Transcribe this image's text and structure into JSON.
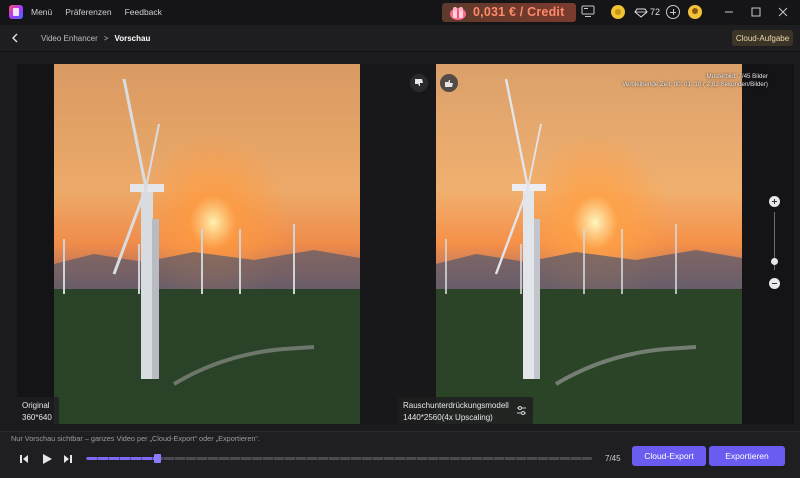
{
  "titlebar": {
    "menu": [
      "Menü",
      "Präferenzen",
      "Feedback"
    ],
    "credit_text": "0,031 € / Credit",
    "gem_count": "72"
  },
  "breadcrumb": {
    "parent": "Video Enhancer",
    "separator": ">",
    "current": "Vorschau"
  },
  "cloud_task_label": "Cloud-Aufgabe",
  "preview": {
    "info_line1": "Musterbild: 7/45 Bilder",
    "info_line2": "Verbleibende Zeit: 00: 01: 10 ( 2,82 Sekunden/Bilder)",
    "left_label": "Original",
    "left_resolution": "360*640",
    "right_label": "Rauschunterdrückungsmodell",
    "right_resolution": "1440*2560(4x Upscaling)"
  },
  "footer": {
    "note": "Nur Vorschau sichtbar – ganzes Video per „Cloud-Export“ oder „Exportieren“.",
    "frame_counter": "7/45",
    "progress_fraction": 0.14,
    "cloud_export_label": "Cloud-Export",
    "export_label": "Exportieren"
  },
  "zoom_level_fraction": 0.85,
  "colors": {
    "accent": "#6a5cf0",
    "credit_text": "#ff8a6a"
  }
}
